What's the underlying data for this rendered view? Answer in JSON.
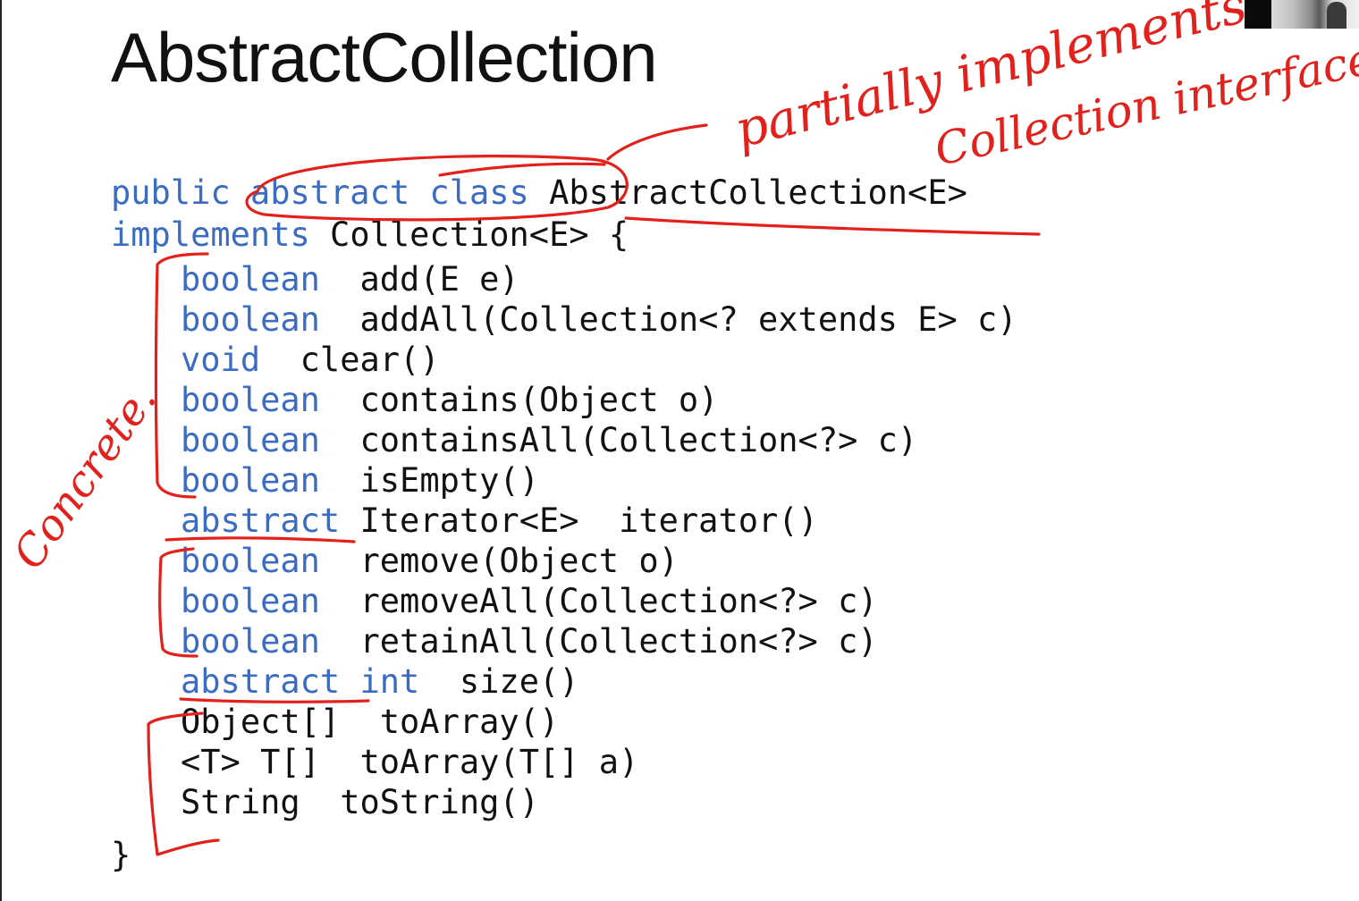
{
  "slide": {
    "title": "AbstractCollection"
  },
  "code": {
    "decl_line1": [
      {
        "text": "public abstract class ",
        "kind": "kw"
      },
      {
        "text": "AbstractCollection<E>",
        "kind": "plain"
      }
    ],
    "decl_line2": [
      {
        "text": "implements ",
        "kind": "kw"
      },
      {
        "text": "Collection<E> {",
        "kind": "plain"
      }
    ],
    "methods": [
      [
        {
          "text": "boolean",
          "kind": "kw"
        },
        {
          "text": "  add(E e)",
          "kind": "plain"
        }
      ],
      [
        {
          "text": "boolean",
          "kind": "kw"
        },
        {
          "text": "  addAll(Collection<? extends E> c)",
          "kind": "plain"
        }
      ],
      [
        {
          "text": "void",
          "kind": "kw"
        },
        {
          "text": "  clear()",
          "kind": "plain"
        }
      ],
      [
        {
          "text": "boolean",
          "kind": "kw"
        },
        {
          "text": "  contains(Object o)",
          "kind": "plain"
        }
      ],
      [
        {
          "text": "boolean",
          "kind": "kw"
        },
        {
          "text": "  containsAll(Collection<?> c)",
          "kind": "plain"
        }
      ],
      [
        {
          "text": "boolean",
          "kind": "kw"
        },
        {
          "text": "  isEmpty()",
          "kind": "plain"
        }
      ],
      [
        {
          "text": "abstract",
          "kind": "kw"
        },
        {
          "text": " Iterator<E>  iterator()",
          "kind": "plain"
        }
      ],
      [
        {
          "text": "boolean",
          "kind": "kw"
        },
        {
          "text": "  remove(Object o)",
          "kind": "plain"
        }
      ],
      [
        {
          "text": "boolean",
          "kind": "kw"
        },
        {
          "text": "  removeAll(Collection<?> c)",
          "kind": "plain"
        }
      ],
      [
        {
          "text": "boolean",
          "kind": "kw"
        },
        {
          "text": "  retainAll(Collection<?> c)",
          "kind": "plain"
        }
      ],
      [
        {
          "text": "abstract int",
          "kind": "kw"
        },
        {
          "text": "  size()",
          "kind": "plain"
        }
      ],
      [
        {
          "text": "Object[]  toArray()",
          "kind": "plain"
        }
      ],
      [
        {
          "text": "<T> T[]  toArray(T[] a)",
          "kind": "plain"
        }
      ],
      [
        {
          "text": "String  toString()",
          "kind": "plain"
        }
      ]
    ],
    "closing_brace": "}"
  },
  "annotations": {
    "note_top_line1": "partially implements",
    "note_top_line2": "Collection interface",
    "note_left": "Concrete."
  },
  "colors": {
    "keyword": "#3c6cc1",
    "text": "#111111",
    "ink": "#e3211c",
    "background": "#ffffff"
  },
  "icons": {
    "webcam": "webcam-thumbnail"
  }
}
